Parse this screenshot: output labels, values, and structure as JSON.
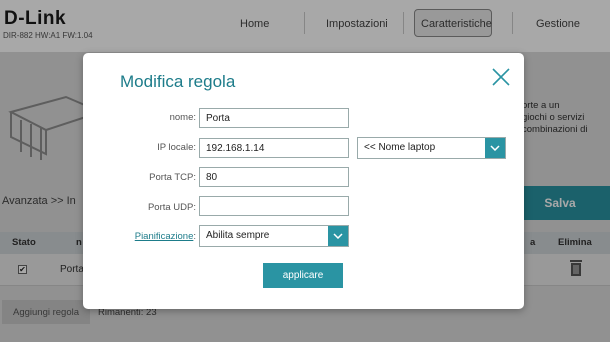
{
  "header": {
    "logo": "D-Link",
    "model": "DIR-882 HW:A1 FW:1.04",
    "nav": [
      "Home",
      "Impostazioni",
      "Caratteristiche",
      "Gestione"
    ],
    "active_nav": "Caratteristiche"
  },
  "page": {
    "intro_lines": [
      "orte a un",
      "giochi o servizi",
      "combinazioni di"
    ],
    "breadcrumb": "Avanzata >> In",
    "save_label": "Salva",
    "table": {
      "col_stato": "Stato",
      "col_name": "n",
      "col_rest": "a",
      "col_elimina": "Elimina",
      "rows": [
        {
          "checked": "✔",
          "name": "Porta"
        }
      ]
    },
    "add_rule_label": "Aggiungi regola",
    "remaining_label": "Rimanenti: 23"
  },
  "modal": {
    "title": "Modifica regola",
    "fields": {
      "nome_label": "nome:",
      "nome_value": "Porta",
      "ip_label": "IP locale:",
      "ip_value": "192.168.1.14",
      "device_select": "<< Nome laptop",
      "tcp_label": "Porta TCP:",
      "tcp_value": "80",
      "udp_label": "Porta UDP:",
      "udp_value": "",
      "schedule_label": "Pianificazione",
      "schedule_colon": ":",
      "schedule_value": "Abilita sempre"
    },
    "apply_label": "applicare"
  },
  "colors": {
    "accent": "#2a94a3",
    "title": "#1d7c8a"
  }
}
